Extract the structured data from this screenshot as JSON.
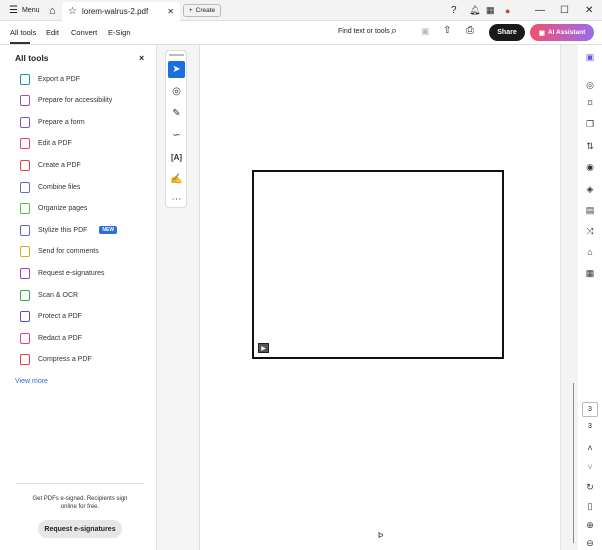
{
  "titlebar": {
    "menu": "Menu",
    "tab_title": "lorem-walrus-2.pdf",
    "create": "Create"
  },
  "toolbar": {
    "tabs": [
      "All tools",
      "Edit",
      "Convert",
      "E-Sign"
    ],
    "find": "Find text or tools",
    "share": "Share",
    "ai": "AI Assistant"
  },
  "sidebar": {
    "title": "All tools",
    "items": [
      {
        "label": "Export a PDF",
        "color": "#1a9a9a"
      },
      {
        "label": "Prepare for accessibility",
        "color": "#8a4fd8"
      },
      {
        "label": "Prepare a form",
        "color": "#8a4fd8"
      },
      {
        "label": "Edit a PDF",
        "color": "#e0447a"
      },
      {
        "label": "Create a PDF",
        "color": "#e04444"
      },
      {
        "label": "Combine files",
        "color": "#5a6ad8"
      },
      {
        "label": "Organize pages",
        "color": "#5ab84a"
      },
      {
        "label": "Stylize this PDF",
        "color": "#5a6ad8"
      },
      {
        "label": "Send for comments",
        "color": "#d8a820"
      },
      {
        "label": "Request e-signatures",
        "color": "#a040c8"
      },
      {
        "label": "Scan & OCR",
        "color": "#3aa84a"
      },
      {
        "label": "Protect a PDF",
        "color": "#5a4ad8"
      },
      {
        "label": "Redact a PDF",
        "color": "#e0447a"
      },
      {
        "label": "Compress a PDF",
        "color": "#e04444"
      }
    ],
    "new_badge": "NEW",
    "view_more": "View more",
    "promo": "Get PDFs e-signed. Recipients sign online for free.",
    "promo_button": "Request e-signatures"
  },
  "page": {
    "current": "3",
    "total": "3",
    "cursor": "Þ"
  }
}
